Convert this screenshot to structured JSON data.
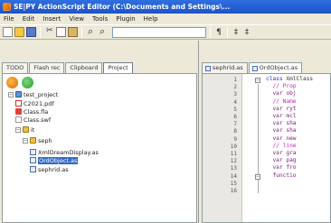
{
  "window": {
    "title": "SE|PY ActionScript Editor (C:\\Documents and Settings\\..."
  },
  "menu": [
    "File",
    "Edit",
    "Insert",
    "View",
    "Tools",
    "Plugin",
    "Help"
  ],
  "left_tabs": [
    "TODO",
    "Flash rec",
    "Clipboard",
    "Project"
  ],
  "left_active_tab": "Project",
  "tree": [
    {
      "label": "test_project",
      "icon": "project-icon",
      "level": 0
    },
    {
      "label": "C2021.pdf",
      "icon": "pdf-icon",
      "level": 1
    },
    {
      "label": "Class.fla",
      "icon": "fla-icon",
      "level": 1
    },
    {
      "label": "Class.swf",
      "icon": "swf-icon",
      "level": 1
    },
    {
      "label": "it",
      "icon": "folder-icon",
      "level": 1
    },
    {
      "label": "seph",
      "icon": "folder-icon",
      "level": 2
    },
    {
      "label": "XmlDreamDisplay.as",
      "icon": "as-icon",
      "level": 3
    },
    {
      "label": "OrdObject.as",
      "icon": "as-icon",
      "level": 3,
      "selected": true
    },
    {
      "label": "sephrid.as",
      "icon": "as-icon",
      "level": 3
    }
  ],
  "editor_tabs": [
    {
      "label": "sephrid.as",
      "active": false
    },
    {
      "label": "OrdObject.as",
      "active": true
    }
  ],
  "line_numbers": [
    "1",
    "2",
    "3",
    "4",
    "5",
    "6",
    "7",
    "8",
    "9",
    "10",
    "11",
    "12",
    "13",
    "14",
    "15",
    "16"
  ],
  "code_lines": [
    {
      "parts": [
        {
          "t": "class ",
          "c": "kw"
        },
        {
          "t": "XmlClass",
          "c": "cls"
        }
      ]
    },
    {
      "parts": [
        {
          "t": "  // Prop",
          "c": "cmt"
        }
      ]
    },
    {
      "parts": [
        {
          "t": "  var obj",
          "c": "var"
        }
      ]
    },
    {
      "parts": [
        {
          "t": "  // Name",
          "c": "cmt"
        }
      ]
    },
    {
      "parts": [
        {
          "t": "  var ryt",
          "c": "var"
        }
      ]
    },
    {
      "parts": [
        {
          "t": "  var mcl",
          "c": "var"
        }
      ]
    },
    {
      "parts": [
        {
          "t": "  var sha",
          "c": "var"
        }
      ]
    },
    {
      "parts": [
        {
          "t": "  var sha",
          "c": "var"
        }
      ]
    },
    {
      "parts": [
        {
          "t": "  var new",
          "c": "var"
        }
      ]
    },
    {
      "parts": [
        {
          "t": "  // line",
          "c": "cmt"
        }
      ]
    },
    {
      "parts": [
        {
          "t": "  var gra",
          "c": "var"
        }
      ]
    },
    {
      "parts": [
        {
          "t": "  var pag",
          "c": "var"
        }
      ]
    },
    {
      "parts": [
        {
          "t": "  var fro",
          "c": "var"
        }
      ]
    },
    {
      "parts": [
        {
          "t": "  functio",
          "c": "fn"
        }
      ]
    },
    {
      "parts": [
        {
          "t": "    ",
          "c": "cls"
        }
      ]
    },
    {
      "parts": [
        {
          "t": "",
          "c": "cls"
        }
      ]
    }
  ]
}
